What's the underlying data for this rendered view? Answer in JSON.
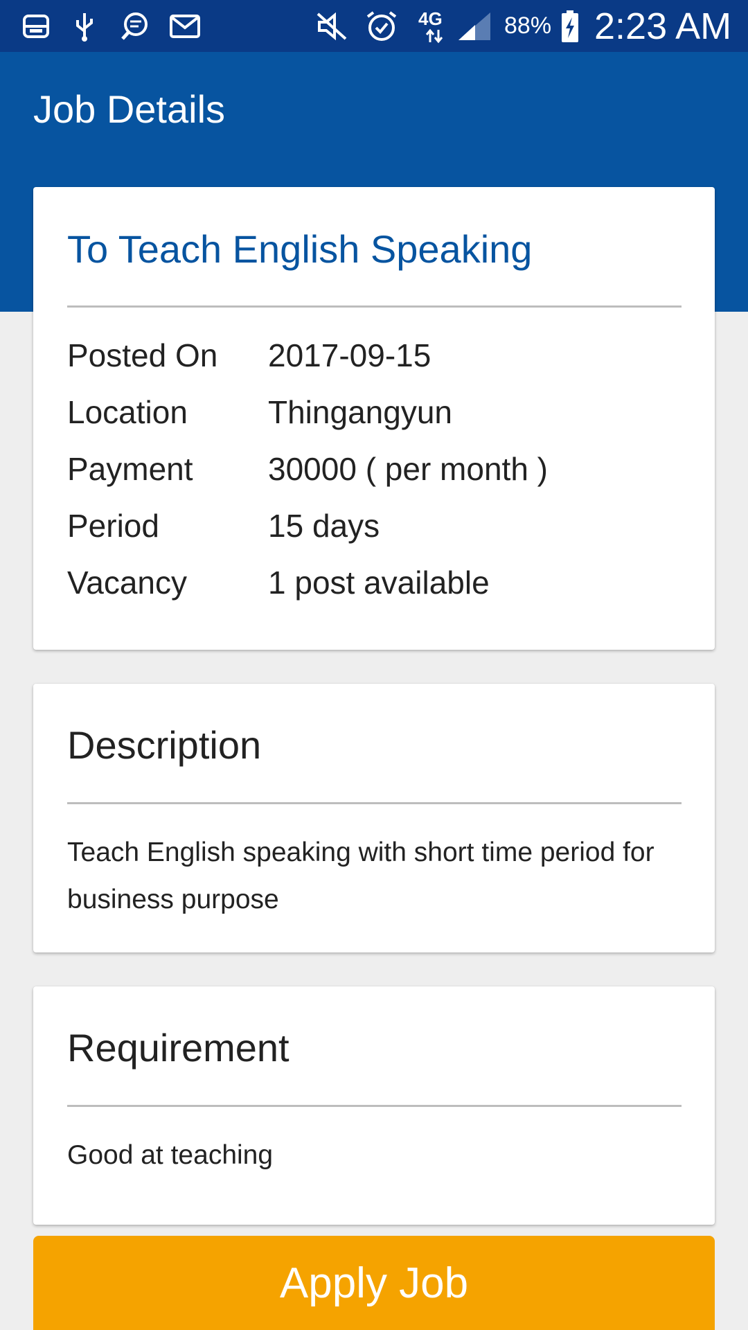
{
  "status_bar": {
    "battery": "88%",
    "network": "4G",
    "time": "2:23 AM",
    "left_icons": [
      "storage-icon",
      "usb-icon",
      "messenger-icon",
      "gmail-icon"
    ],
    "right_icons": [
      "mute-icon",
      "alarm-icon",
      "network-4g-icon",
      "signal-icon",
      "battery-charging-icon"
    ]
  },
  "app_bar": {
    "title": "Job Details",
    "color": "#0754a0"
  },
  "job": {
    "title": "To Teach English Speaking",
    "details": [
      {
        "label": "Posted On",
        "value": "2017-09-15"
      },
      {
        "label": "Location",
        "value": "Thingangyun"
      },
      {
        "label": "Payment",
        "value": "30000 ( per month )"
      },
      {
        "label": "Period",
        "value": "15 days"
      },
      {
        "label": "Vacancy",
        "value": "1 post available"
      }
    ]
  },
  "description": {
    "heading": "Description",
    "text": "Teach English speaking with short time period for business purpose"
  },
  "requirement": {
    "heading": "Requirement",
    "text": "Good at teaching"
  },
  "apply_button": {
    "label": "Apply Job",
    "color": "#f5a300"
  }
}
